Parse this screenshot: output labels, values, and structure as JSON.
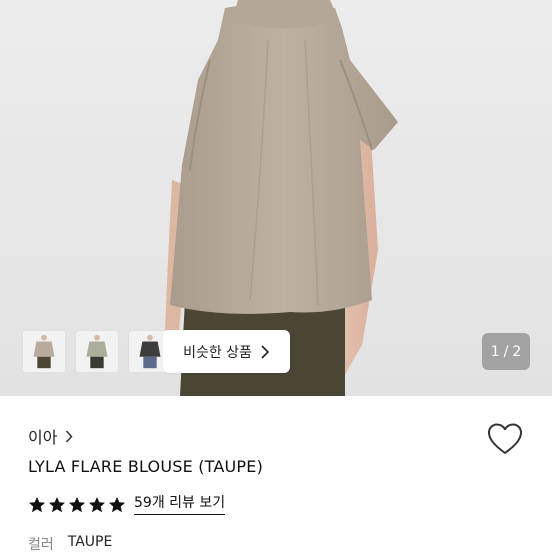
{
  "gallery": {
    "similar_label": "비슷한 상품",
    "pager": {
      "current": "1",
      "separator": "/",
      "total": "2"
    },
    "thumbnails": [
      {
        "alt": "taupe blouse thumbnail"
      },
      {
        "alt": "sage blouse thumbnail"
      },
      {
        "alt": "charcoal blouse thumbnail"
      }
    ]
  },
  "product": {
    "seller": "이아",
    "title": "LYLA FLARE BLOUSE (TAUPE)",
    "rating": {
      "stars": 5,
      "max": 5,
      "review_label": "59개 리뷰 보기"
    },
    "option": {
      "label": "컬러",
      "value": "TAUPE"
    }
  },
  "colors": {
    "star": "#111111",
    "heart_stroke": "#333333",
    "taupe": "#b8ab9c",
    "skirt": "#4b4535"
  }
}
